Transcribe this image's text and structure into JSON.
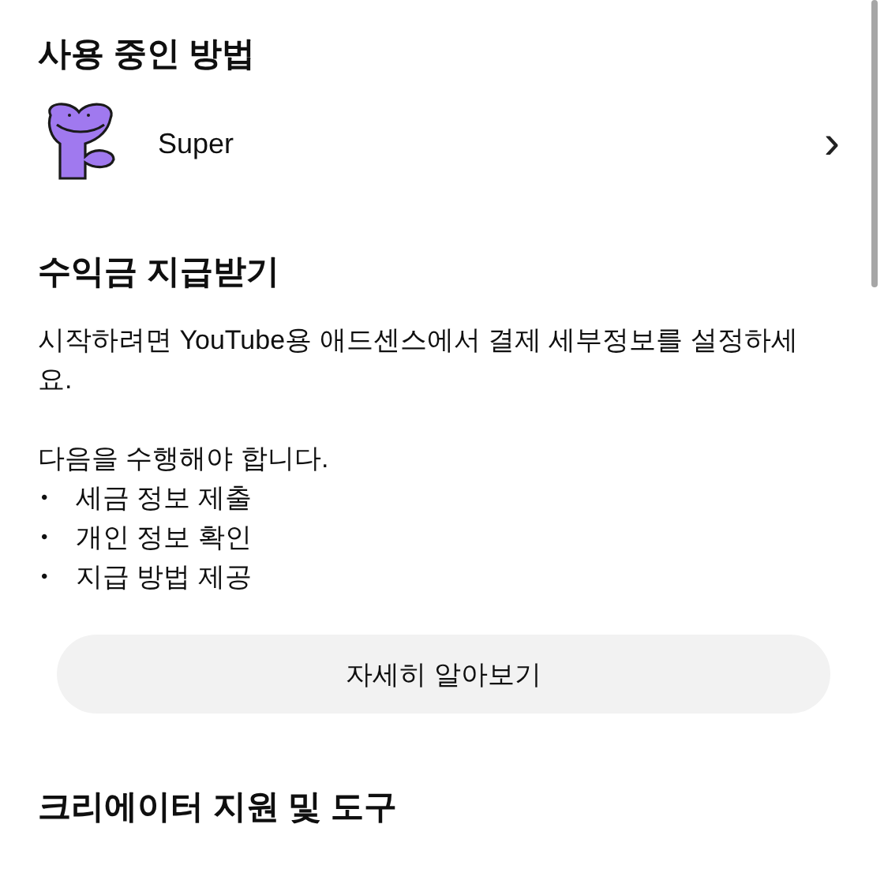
{
  "current_method": {
    "heading": "사용 중인 방법",
    "item": {
      "label": "Super",
      "chevron": "›"
    }
  },
  "payout": {
    "heading": "수익금 지급받기",
    "description": "시작하려면 YouTube용 애드센스에서 결제 세부정보를 설정하세요.",
    "intro": "다음을 수행해야 합니다.",
    "steps": [
      {
        "bullet": "•",
        "text": "세금 정보 제출"
      },
      {
        "bullet": "•",
        "text": "개인 정보 확인"
      },
      {
        "bullet": "•",
        "text": "지급 방법 제공"
      }
    ],
    "button": "자세히 알아보기"
  },
  "creator_tools": {
    "heading": "크리에이터 지원 및 도구"
  }
}
